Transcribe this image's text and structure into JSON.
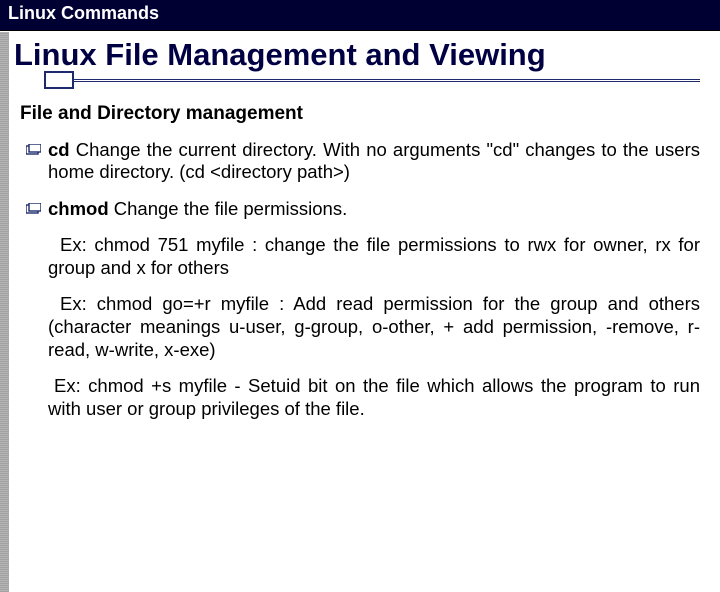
{
  "header": {
    "title": "Linux Commands"
  },
  "slide": {
    "title": "Linux File Management and Viewing",
    "subtitle": "File and Directory management"
  },
  "items": [
    {
      "cmd": "cd",
      "desc": " Change the current directory. With no arguments \"cd\" changes to the users home directory. (cd <directory path>)"
    },
    {
      "cmd": "chmod",
      "desc": " Change the file permissions."
    }
  ],
  "examples": [
    "Ex: chmod 751 myfile : change the file permissions to rwx for owner, rx for group and x for others",
    "Ex: chmod go=+r myfile : Add read permission for the group and others (character meanings u-user, g-group, o-other, + add permission, -remove, r-read, w-write, x-exe)",
    "Ex: chmod +s myfile - Setuid bit on the file which allows the program to run with user or group privileges of the file."
  ]
}
